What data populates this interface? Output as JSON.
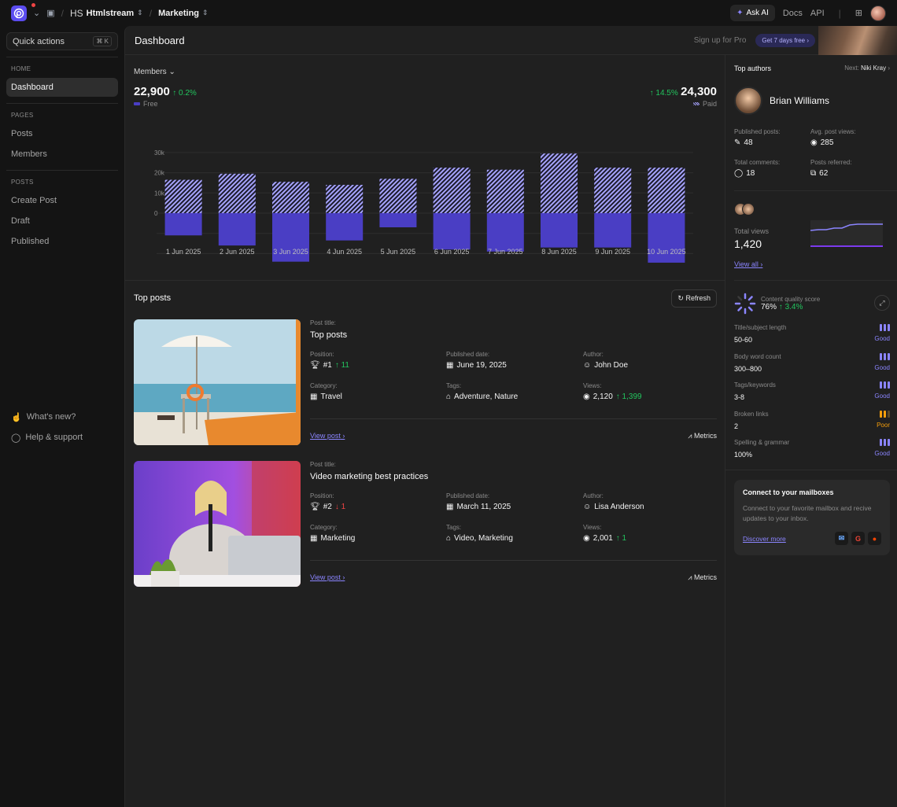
{
  "topbar": {
    "workspace_initials": "HS",
    "workspace": "Htmlstream",
    "project": "Marketing",
    "ask_ai": "Ask AI",
    "docs": "Docs",
    "api": "API"
  },
  "sidebar": {
    "quick_actions": "Quick actions",
    "shortcut": "⌘ K",
    "home_heading": "HOME",
    "home_items": [
      {
        "label": "Dashboard"
      }
    ],
    "pages_heading": "PAGES",
    "pages_items": [
      {
        "label": "Posts"
      },
      {
        "label": "Members"
      }
    ],
    "posts_heading": "POSTS",
    "posts_items": [
      {
        "label": "Create Post"
      },
      {
        "label": "Draft"
      },
      {
        "label": "Published"
      }
    ],
    "footer": [
      {
        "label": "What's new?"
      },
      {
        "label": "Help & support"
      }
    ]
  },
  "header": {
    "title": "Dashboard",
    "signup": "Sign up for Pro",
    "cta": "Get 7 days free"
  },
  "members": {
    "dropdown": "Members",
    "free_value": "22,900",
    "free_change": "0.2%",
    "free_label": "Free",
    "paid_value": "24,300",
    "paid_change": "14.5%",
    "paid_label": "Paid"
  },
  "chart_data": {
    "type": "bar",
    "categories": [
      "1 Jun 2025",
      "2 Jun 2025",
      "3 Jun 2025",
      "4 Jun 2025",
      "5 Jun 2025",
      "6 Jun 2025",
      "7 Jun 2025",
      "8 Jun 2025",
      "9 Jun 2025",
      "10 Jun 2025"
    ],
    "y_ticks": [
      "30k",
      "20k",
      "10k",
      "0"
    ],
    "series": [
      {
        "name": "Paid",
        "values": [
          16500,
          19500,
          15500,
          14000,
          17000,
          22500,
          21500,
          29500,
          22500,
          22500
        ],
        "color": "#a7a4ff"
      },
      {
        "name": "Free",
        "values": [
          -11000,
          -16000,
          -24000,
          -13500,
          -7000,
          -18000,
          -19000,
          -17000,
          -17000,
          -24500
        ],
        "color": "#4a3ec4"
      }
    ],
    "ylim": [
      -30000,
      30000
    ]
  },
  "top_posts": {
    "title": "Top posts",
    "refresh": "Refresh",
    "labels": {
      "post_title": "Post title:",
      "position": "Position:",
      "published": "Published date:",
      "author": "Author:",
      "category": "Category:",
      "tags": "Tags:",
      "views": "Views:"
    },
    "view_post": "View post",
    "metrics": "Metrics",
    "posts": [
      {
        "title": "Top posts",
        "position": "#1",
        "position_change": "11",
        "date": "June 19, 2025",
        "author": "John Doe",
        "category": "Travel",
        "tags": "Adventure, Nature",
        "views": "2,120",
        "views_change": "1,399"
      },
      {
        "title": "Video marketing best practices",
        "position": "#2",
        "position_change": "1",
        "date": "March 11, 2025",
        "author": "Lisa Anderson",
        "category": "Marketing",
        "tags": "Video, Marketing",
        "views": "2,001",
        "views_change": "1"
      }
    ]
  },
  "authors": {
    "title": "Top authors",
    "next_label": "Next:",
    "next_name": "Niki Kray",
    "name": "Brian Williams",
    "published_label": "Published posts:",
    "published": "48",
    "avg_label": "Avg. post views:",
    "avg": "285",
    "comments_label": "Total comments:",
    "comments": "18",
    "referred_label": "Posts referred:",
    "referred": "62",
    "views_label": "Total views",
    "views": "1,420",
    "view_all": "View all"
  },
  "quality": {
    "label": "Content quality score",
    "score": "76%",
    "change": "3.4%",
    "items": [
      {
        "label": "Title/subject length",
        "value": "50-60",
        "rating": "Good"
      },
      {
        "label": "Body word count",
        "value": "300–800",
        "rating": "Good"
      },
      {
        "label": "Tags/keywords",
        "value": "3-8",
        "rating": "Good"
      },
      {
        "label": "Broken links",
        "value": "2",
        "rating": "Poor"
      },
      {
        "label": "Spelling & grammar",
        "value": "100%",
        "rating": "Good"
      }
    ]
  },
  "mailbox": {
    "title": "Connect to your mailboxes",
    "description": "Connect to your favorite mailbox and recive updates to your inbox.",
    "link": "Discover more"
  },
  "colors": {
    "accent": "#8b85ff",
    "good": "#8b85ff",
    "poor": "#f59e0b",
    "up": "#22c55e",
    "down": "#ef4444"
  }
}
